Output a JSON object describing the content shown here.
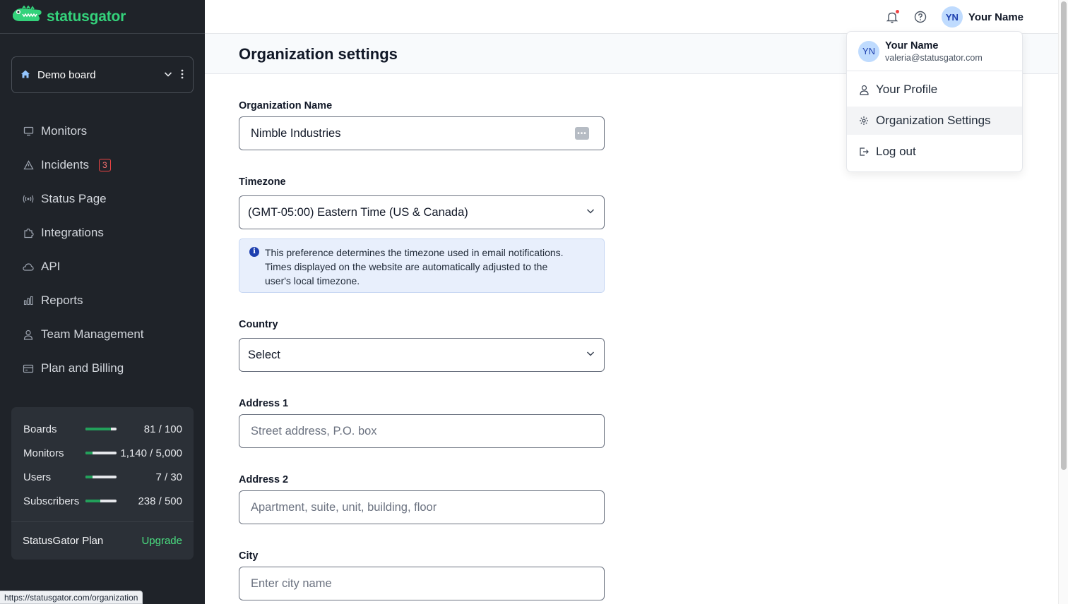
{
  "app": {
    "logo_text": "statusgator",
    "brand_color": "#34d27b"
  },
  "board_selector": {
    "label": "Demo board",
    "icon": "home-icon"
  },
  "nav": {
    "items": [
      {
        "label": "Monitors",
        "icon": "monitor-icon"
      },
      {
        "label": "Incidents",
        "icon": "warning-triangle-icon",
        "badge": "3"
      },
      {
        "label": "Status Page",
        "icon": "broadcast-icon"
      },
      {
        "label": "Integrations",
        "icon": "puzzle-icon"
      },
      {
        "label": "API",
        "icon": "cloud-icon"
      },
      {
        "label": "Reports",
        "icon": "bar-chart-icon"
      },
      {
        "label": "Team Management",
        "icon": "user-icon"
      },
      {
        "label": "Plan and Billing",
        "icon": "credit-card-icon"
      }
    ]
  },
  "usage": {
    "rows": [
      {
        "label": "Boards",
        "value": "81 / 100",
        "fraction": 0.81
      },
      {
        "label": "Monitors",
        "value": "1,140 / 5,000",
        "fraction": 0.228
      },
      {
        "label": "Users",
        "value": "7 / 30",
        "fraction": 0.233
      },
      {
        "label": "Subscribers",
        "value": "238 / 500",
        "fraction": 0.476
      }
    ],
    "plan_label": "StatusGator Plan",
    "upgrade_label": "Upgrade"
  },
  "status_bar": {
    "url": "https://statusgator.com/organization"
  },
  "topbar": {
    "avatar_initials": "YN",
    "user_name": "Your Name"
  },
  "page": {
    "title": "Organization settings"
  },
  "form": {
    "org_name": {
      "label": "Organization Name",
      "value": "Nimble Industries"
    },
    "timezone": {
      "label": "Timezone",
      "value": "(GMT-05:00) Eastern Time (US & Canada)",
      "info_line1": "This preference determines the timezone used in email notifications.",
      "info_line2": "Times displayed on the website are automatically adjusted to the",
      "info_line3": "user's local timezone."
    },
    "country": {
      "label": "Country",
      "value": "Select"
    },
    "address1": {
      "label": "Address 1",
      "placeholder": "Street address, P.O. box"
    },
    "address2": {
      "label": "Address 2",
      "placeholder": "Apartment, suite, unit, building, floor"
    },
    "city": {
      "label": "City",
      "placeholder": "Enter city name"
    }
  },
  "user_menu": {
    "avatar_initials": "YN",
    "name": "Your Name",
    "email": "valeria@statusgator.com",
    "items": [
      {
        "label": "Your Profile",
        "icon": "user-icon"
      },
      {
        "label": "Organization Settings",
        "icon": "gear-icon",
        "active": true
      },
      {
        "label": "Log out",
        "icon": "logout-icon"
      }
    ]
  }
}
